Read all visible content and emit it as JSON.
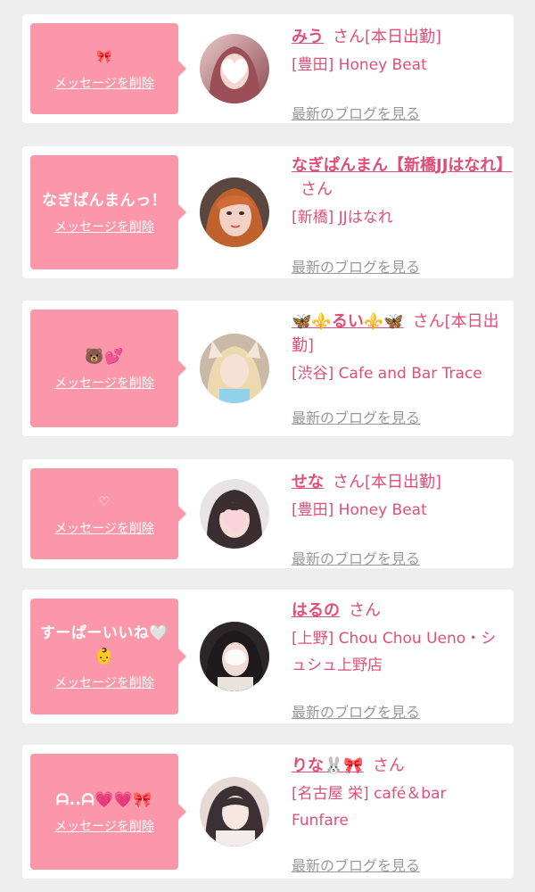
{
  "delete_label": "メッセージを削除",
  "blog_label": "最新のブログを見る",
  "san_label": "さん",
  "colors": {
    "background": "#eeeeee",
    "bubble": "#fc97a9",
    "accent": "#e14f78",
    "link_gray": "#999999"
  },
  "entries": [
    {
      "message": "🎀",
      "name": "みう",
      "suffix": "さん[本日出勤]",
      "shop": "[豊田] Honey Beat"
    },
    {
      "message": "なぎぱんまんっ！",
      "name": "なぎぱんまん【新橋JJはなれ】",
      "suffix": "さん",
      "shop": "[新橋] JJはなれ"
    },
    {
      "message": "🐻💕",
      "name": "🦋⚜️るい⚜️🦋",
      "suffix": "さん[本日出勤]",
      "shop": "[渋谷] Cafe and Bar Trace"
    },
    {
      "message": "♡",
      "name": "せな",
      "suffix": "さん[本日出勤]",
      "shop": "[豊田] Honey Beat"
    },
    {
      "message": "すーぱーいいね🤍👶",
      "name": "はるの",
      "suffix": "さん",
      "shop": "[上野] Chou Chou Ueno・シュシュ上野店"
    },
    {
      "message": "ᗩ..ᗩ💗💗🎀",
      "name": "りな🐰🎀",
      "suffix": "さん",
      "shop": "[名古屋 栄] café＆bar Funfare"
    }
  ]
}
